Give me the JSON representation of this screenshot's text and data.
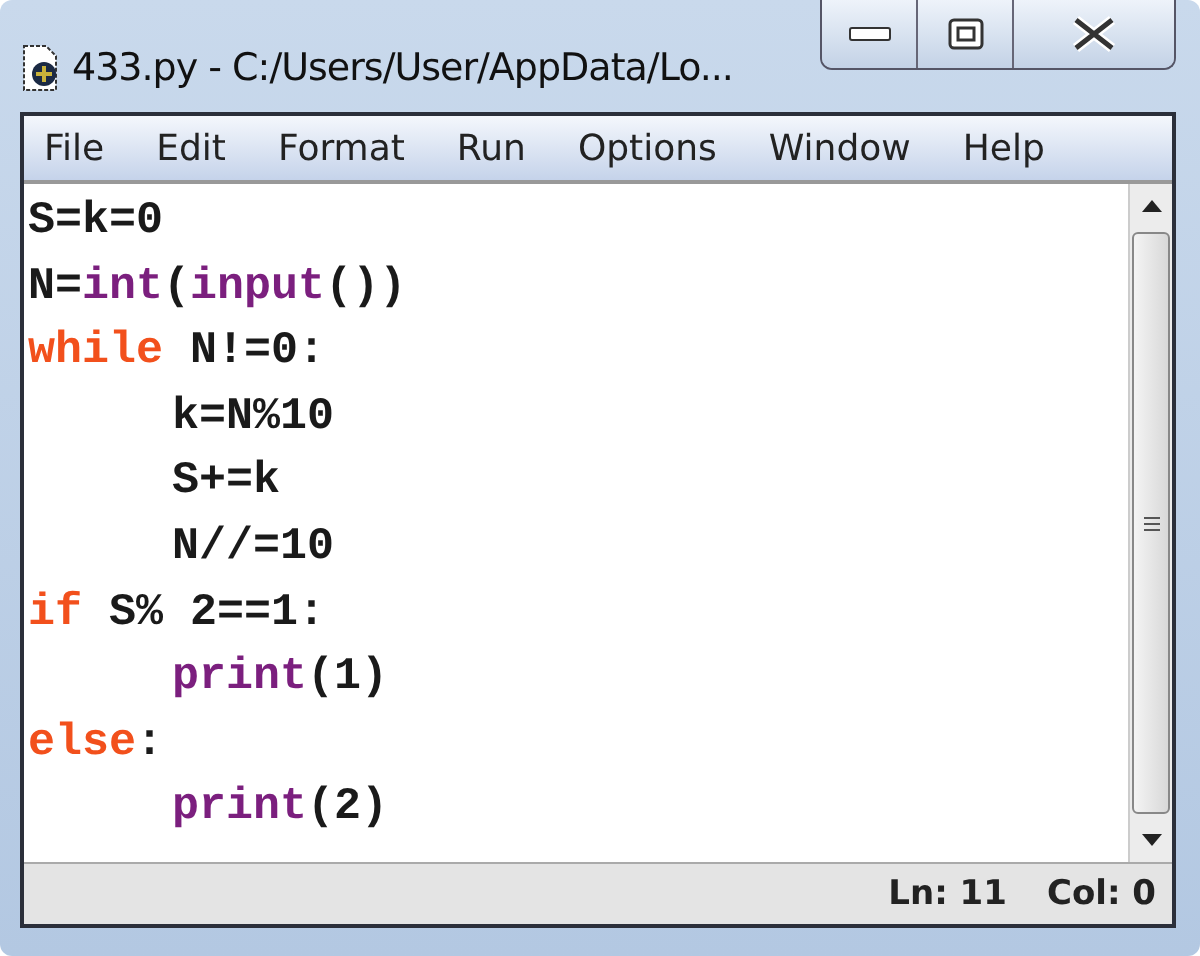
{
  "window": {
    "title": "433.py - C:/Users/User/AppData/Lo..."
  },
  "menu": [
    "File",
    "Edit",
    "Format",
    "Run",
    "Options",
    "Window",
    "Help"
  ],
  "code": [
    {
      "indented": false,
      "tokens": [
        {
          "kind": "plain",
          "text": "S=k=0"
        }
      ]
    },
    {
      "indented": false,
      "tokens": [
        {
          "kind": "plain",
          "text": "N="
        },
        {
          "kind": "builtin",
          "text": "int"
        },
        {
          "kind": "plain",
          "text": "("
        },
        {
          "kind": "builtin",
          "text": "input"
        },
        {
          "kind": "plain",
          "text": "())"
        }
      ]
    },
    {
      "indented": false,
      "tokens": [
        {
          "kind": "keyword",
          "text": "while"
        },
        {
          "kind": "plain",
          "text": " N!=0:"
        }
      ]
    },
    {
      "indented": true,
      "tokens": [
        {
          "kind": "plain",
          "text": "k=N%10"
        }
      ]
    },
    {
      "indented": true,
      "tokens": [
        {
          "kind": "plain",
          "text": "S+=k"
        }
      ]
    },
    {
      "indented": true,
      "tokens": [
        {
          "kind": "plain",
          "text": "N//=10"
        }
      ]
    },
    {
      "indented": false,
      "tokens": [
        {
          "kind": "keyword",
          "text": "if"
        },
        {
          "kind": "plain",
          "text": " S% 2==1:"
        }
      ]
    },
    {
      "indented": true,
      "tokens": [
        {
          "kind": "builtin",
          "text": "print"
        },
        {
          "kind": "plain",
          "text": "(1)"
        }
      ]
    },
    {
      "indented": false,
      "tokens": [
        {
          "kind": "keyword",
          "text": "else"
        },
        {
          "kind": "plain",
          "text": ":"
        }
      ]
    },
    {
      "indented": true,
      "tokens": [
        {
          "kind": "builtin",
          "text": "print"
        },
        {
          "kind": "plain",
          "text": "(2)"
        }
      ]
    }
  ],
  "status_bar": {
    "line": "Ln: 11",
    "column": "Col: 0"
  }
}
